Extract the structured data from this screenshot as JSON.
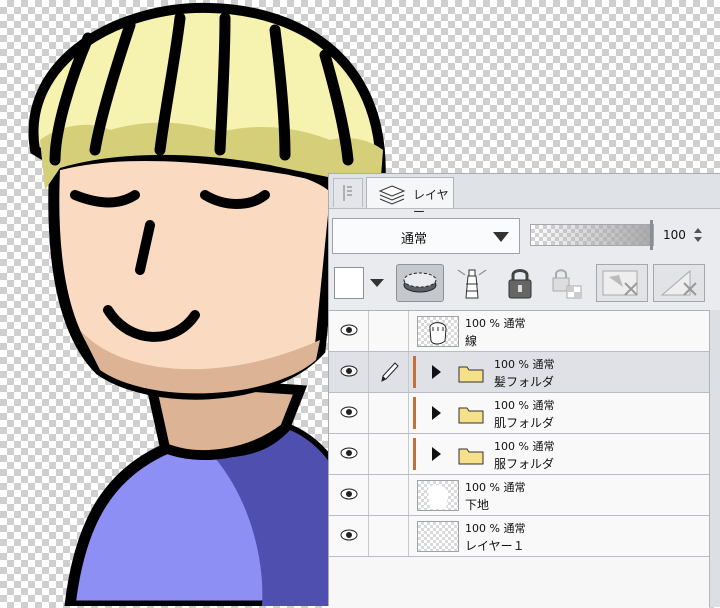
{
  "panel": {
    "tab_label": "レイヤー",
    "blend_mode": "通常",
    "opacity_value": "100",
    "opacity_level": 1.0
  },
  "layers": [
    {
      "opacity_blend": "100 % 通常",
      "name": "線",
      "kind": "layer",
      "thumb": "line-art"
    },
    {
      "opacity_blend": "100 % 通常",
      "name": "髪フォルダ",
      "kind": "folder",
      "selected": true
    },
    {
      "opacity_blend": "100 % 通常",
      "name": "肌フォルダ",
      "kind": "folder"
    },
    {
      "opacity_blend": "100 % 通常",
      "name": "服フォルダ",
      "kind": "folder"
    },
    {
      "opacity_blend": "100 % 通常",
      "name": "下地",
      "kind": "layer",
      "thumb": "white-fill"
    },
    {
      "opacity_blend": "100 % 通常",
      "name": "レイヤー１",
      "kind": "layer",
      "thumb": "empty"
    }
  ],
  "colors": {
    "hair": "#f6f2b0",
    "hair_shadow": "#d6cf7a",
    "skin": "#fadbc2",
    "skin_shadow": "#dcb394",
    "shirt": "#8d8ff5",
    "shirt_shadow": "#4f4fb0",
    "line": "#000000",
    "folder": "#f7e08a"
  },
  "icons": [
    "eye-icon",
    "pen-icon",
    "layers-icon",
    "lock-icon",
    "lock-transparency-icon",
    "reference-icon",
    "clip-icon",
    "mask-icon"
  ]
}
